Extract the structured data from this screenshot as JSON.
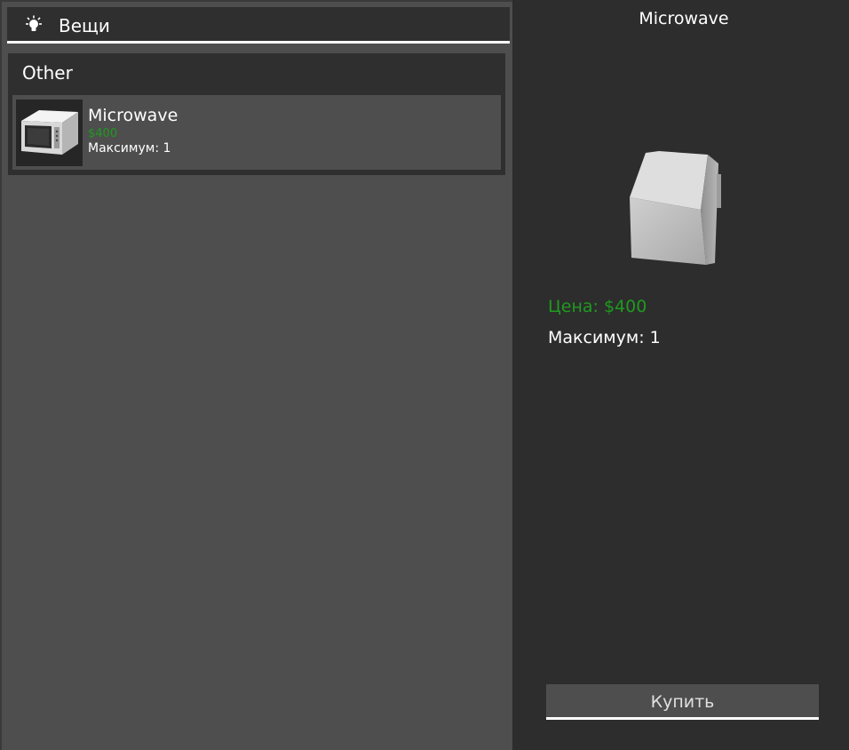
{
  "tab": {
    "title": "Вещи",
    "icon": "lightbulb-icon"
  },
  "category": {
    "title": "Other",
    "items": [
      {
        "name": "Microwave",
        "price": "$400",
        "max": "Максимум: 1",
        "icon": "microwave-icon"
      }
    ]
  },
  "detail": {
    "title": "Microwave",
    "price": "Цена: $400",
    "max": "Максимум: 1",
    "icon": "microwave-model-icon"
  },
  "actions": {
    "buy_label": "Купить"
  },
  "colors": {
    "price_green": "#1f9a1f",
    "panel_dark": "#2d2d2d",
    "panel_mid": "#4e4e4e"
  }
}
